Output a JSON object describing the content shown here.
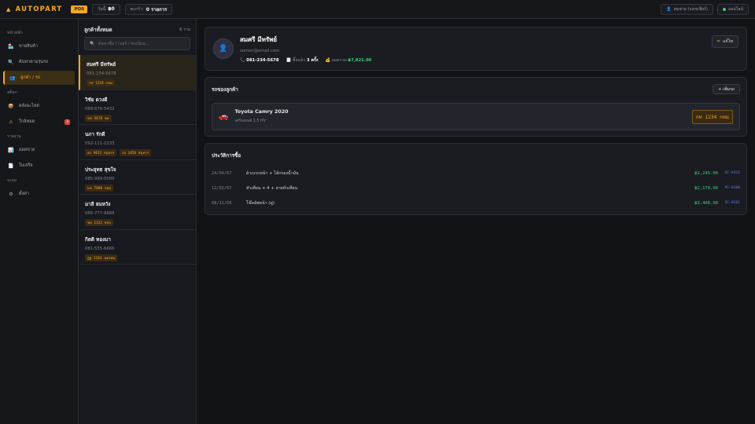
{
  "topbar": {
    "logo": "AUTOPART",
    "pos_badge": "POS",
    "today_label": "วันนี้",
    "today_value": "฿0",
    "cart_label": "ตะกร้า:",
    "cart_value": "0 รายการ",
    "user": "สมชาย (แคชเชียร์)",
    "online": "ออนไลน์"
  },
  "sidebar": {
    "sections": [
      {
        "title": "หน้าหลัก",
        "items": [
          {
            "label": "ขายสินค้า",
            "icon": "cash-register-icon"
          },
          {
            "label": "ค้นหาตามรุ่นรถ",
            "icon": "search-icon"
          },
          {
            "label": "ลูกค้า / รถ",
            "icon": "users-icon",
            "active": true
          }
        ]
      },
      {
        "title": "สต็อก",
        "items": [
          {
            "label": "คลังอะไหล่",
            "icon": "box-icon"
          },
          {
            "label": "ใกล้หมด",
            "icon": "warning-icon",
            "count": "3"
          }
        ]
      },
      {
        "title": "รายงาน",
        "items": [
          {
            "label": "ยอดขาย",
            "icon": "chart-icon"
          },
          {
            "label": "ใบเสร็จ",
            "icon": "receipt-icon"
          }
        ]
      },
      {
        "title": "ระบบ",
        "items": [
          {
            "label": "ตั้งค่า",
            "icon": "gear-icon"
          }
        ]
      }
    ]
  },
  "customers": {
    "title": "ลูกค้าทั้งหมด",
    "count": "6 ราย",
    "search_placeholder": "ค้นหาชื่อ / เบอร์ / ทะเบียน...",
    "items": [
      {
        "name": "สมศรี มีทรัพย์",
        "phone": "081-234-5678",
        "plates": [
          "กท 1234 กทม"
        ],
        "active": true
      },
      {
        "name": "วิชัย ดวงดี",
        "phone": "089-876-5432",
        "plates": [
          "ขค 5678 ชม"
        ]
      },
      {
        "name": "นภา รักดี",
        "phone": "092-111-2233",
        "plates": [
          "คง 9012 สมุทรฯ",
          "งจ 3456 สมุทรฯ"
        ]
      },
      {
        "name": "ประยุทธ สุขใจ",
        "phone": "085-999-0000",
        "plates": [
          "มข 7890 กทม"
        ]
      },
      {
        "name": "มาลี สมหวัง",
        "phone": "086-777-8888",
        "plates": [
          "ชล 1122 ชลบ"
        ]
      },
      {
        "name": "กิตติ ทองมา",
        "phone": "081-555-6666",
        "plates": [
          "ฎฐ 3344 นครพน"
        ]
      }
    ]
  },
  "profile": {
    "name": "สมศรี มีทรัพย์",
    "email": "somsri@email.com",
    "phone": "081-234-5678",
    "visits_label": "ซื้อแล้ว",
    "visits_value": "3 ครั้ง",
    "total_label": "ยอดรวม",
    "total_value": "฿7,821.00",
    "edit_label": "แก้ไข"
  },
  "cars": {
    "title": "รถของลูกค้า",
    "add_label": "+ เพิ่มรถ",
    "items": [
      {
        "model": "Toyota Camry 2020",
        "engine": "เครื่องยนต์ 2.5 HV",
        "plate": "กท 1234 กทม"
      }
    ]
  },
  "history": {
    "title": "ประวัติการซื้อ",
    "rows": [
      {
        "date": "24/04/67",
        "items": "ผ้าเบรกหน้า + ไส้กรองน้ำมัน",
        "amount": "฿2,245.00",
        "ref": "RC-0412"
      },
      {
        "date": "12/02/67",
        "items": "หัวเทียน × 4 + สายหัวเทียน",
        "amount": "฿2,170.00",
        "ref": "RC-0388"
      },
      {
        "date": "08/11/66",
        "items": "โช๊คอัพหน้า (คู่)",
        "amount": "฿3,406.00",
        "ref": "RC-0361"
      }
    ]
  },
  "colors": {
    "accent": "#f2a824",
    "success": "#3ccf7a",
    "danger": "#d8453c",
    "link": "#5b7ae6"
  }
}
